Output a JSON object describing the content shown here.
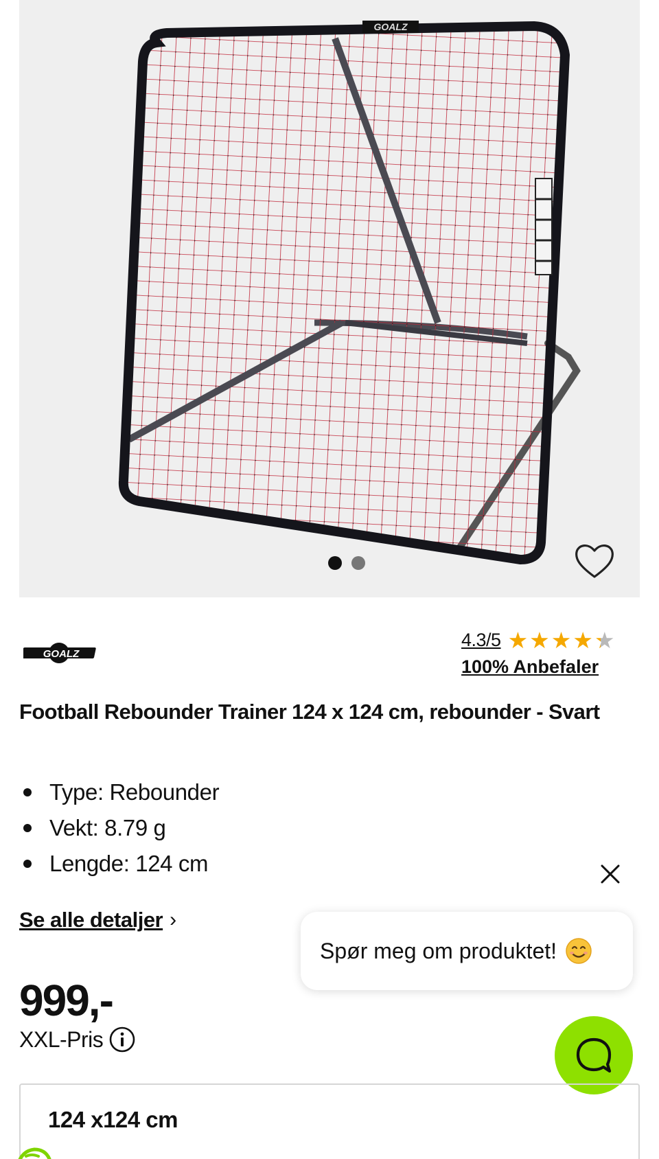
{
  "hero": {
    "image_alt": "GOALZ football rebounder net",
    "frame_brand": "GOALZ",
    "gallery_dots": [
      {
        "active": true
      },
      {
        "active": false
      }
    ],
    "favorite_icon": "heart-outline-icon"
  },
  "brand": {
    "logo_text": "GOALZ"
  },
  "rating": {
    "score": "4.3/5",
    "value": 4.3,
    "max": 5,
    "stars": [
      "★",
      "★",
      "★",
      "★",
      "★"
    ],
    "recommend": "100% Anbefaler",
    "star_color": "#f5a800"
  },
  "product": {
    "title": "Football Rebounder Trainer 124 x 124 cm, rebounder - Svart",
    "specs": [
      "Type: Rebounder",
      "Vekt: 8.79 g",
      "Lengde: 124 cm"
    ]
  },
  "details_link": {
    "label": "Se alle detaljer",
    "chevron": "›"
  },
  "chat": {
    "prompt": "Spør meg om produktet!",
    "emoji": "smiling-face-icon",
    "close_icon": "close-icon",
    "fab_icon": "chat-bubble-icon",
    "fab_color": "#8ee000"
  },
  "price": {
    "amount": "999,-",
    "label": "XXL-Pris",
    "info_icon": "info-icon"
  },
  "size": {
    "selected": "124 x124 cm"
  }
}
